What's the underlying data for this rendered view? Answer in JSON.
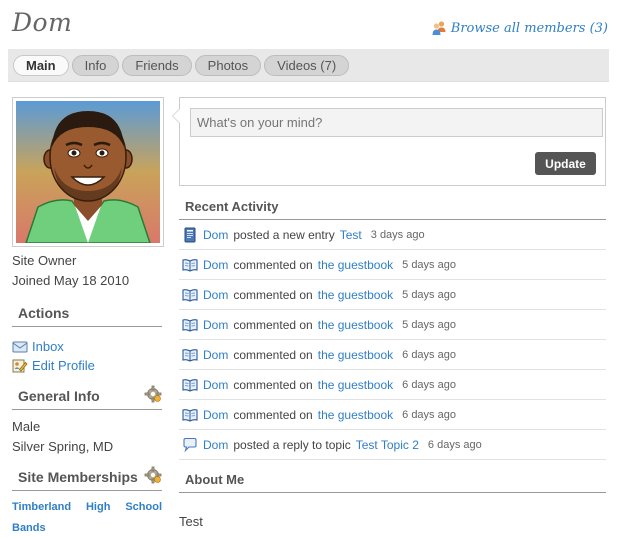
{
  "header": {
    "title": "Dom",
    "browse_label": "Browse all members (3)"
  },
  "tabs": [
    {
      "label": "Main",
      "active": true
    },
    {
      "label": "Info",
      "active": false
    },
    {
      "label": "Friends",
      "active": false
    },
    {
      "label": "Photos",
      "active": false
    },
    {
      "label": "Videos (7)",
      "active": false
    }
  ],
  "profile": {
    "role": "Site Owner",
    "joined": "Joined May 18 2010"
  },
  "actions": {
    "heading": "Actions",
    "items": [
      {
        "label": "Inbox",
        "icon": "inbox-icon"
      },
      {
        "label": "Edit Profile",
        "icon": "edit-profile-icon"
      }
    ]
  },
  "general_info": {
    "heading": "General Info",
    "gender": "Male",
    "location": "Silver Spring, MD"
  },
  "memberships": {
    "heading": "Site Memberships",
    "items": [
      "Timberland High School Bands"
    ]
  },
  "status": {
    "placeholder": "What's on your mind?",
    "button": "Update"
  },
  "activity": {
    "heading": "Recent Activity",
    "items": [
      {
        "icon": "blog-entry-icon",
        "user": "Dom",
        "verb": "posted a new entry",
        "target": "Test",
        "time": "3 days ago"
      },
      {
        "icon": "book-icon",
        "user": "Dom",
        "verb": "commented on",
        "target": "the guestbook",
        "time": "5 days ago"
      },
      {
        "icon": "book-icon",
        "user": "Dom",
        "verb": "commented on",
        "target": "the guestbook",
        "time": "5 days ago"
      },
      {
        "icon": "book-icon",
        "user": "Dom",
        "verb": "commented on",
        "target": "the guestbook",
        "time": "5 days ago"
      },
      {
        "icon": "book-icon",
        "user": "Dom",
        "verb": "commented on",
        "target": "the guestbook",
        "time": "6 days ago"
      },
      {
        "icon": "book-icon",
        "user": "Dom",
        "verb": "commented on",
        "target": "the guestbook",
        "time": "6 days ago"
      },
      {
        "icon": "book-icon",
        "user": "Dom",
        "verb": "commented on",
        "target": "the guestbook",
        "time": "6 days ago"
      },
      {
        "icon": "speech-bubble-icon",
        "user": "Dom",
        "verb": "posted a reply to topic",
        "target": "Test Topic 2",
        "time": "6 days ago"
      }
    ]
  },
  "about": {
    "heading": "About Me",
    "text": "Test"
  },
  "colors": {
    "link": "#2f7fc8",
    "update_button": "#555555",
    "tab_bar": "#e8e8e8"
  }
}
